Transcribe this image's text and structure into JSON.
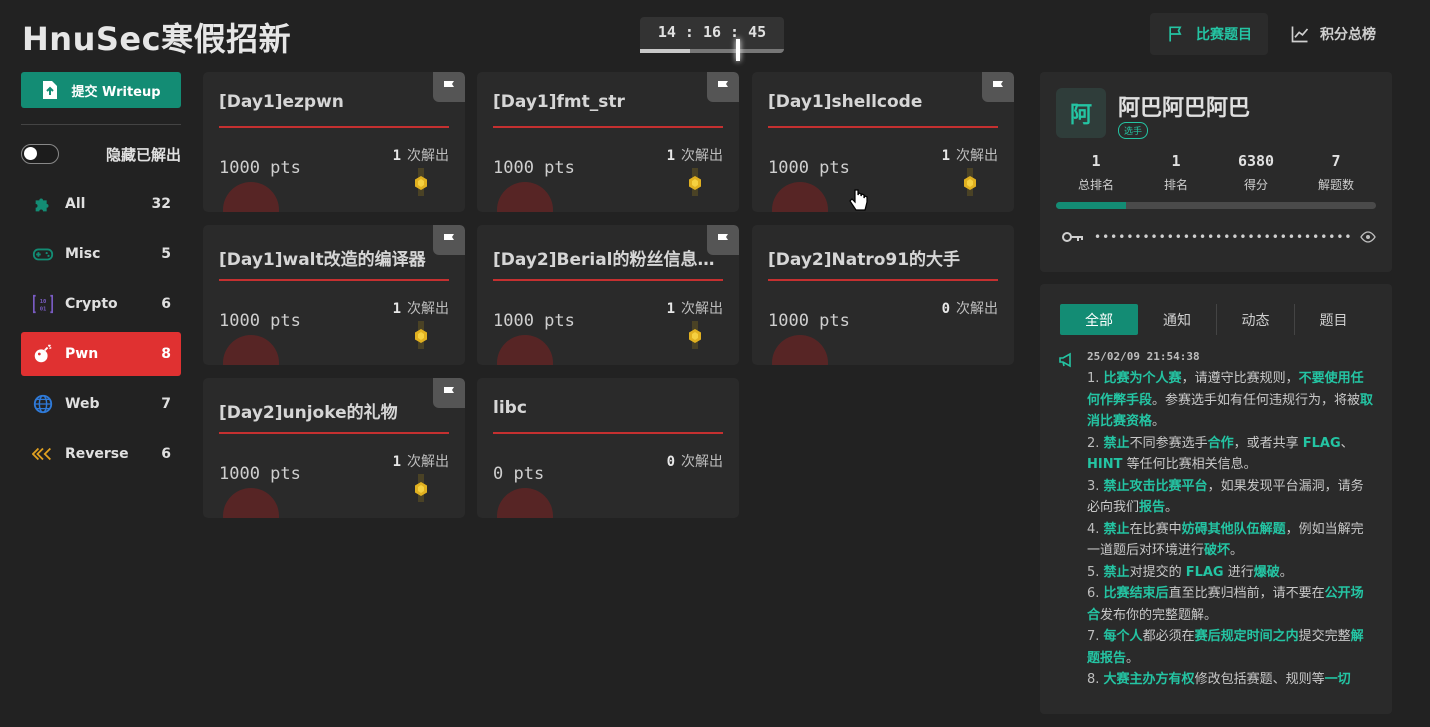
{
  "app": {
    "title": "HnuSec寒假招新",
    "timer": "14 : 16 : 45",
    "timer_progress": 0.35
  },
  "nav": {
    "challenges_label": "比赛题目",
    "scoreboard_label": "积分总榜"
  },
  "sidebar": {
    "submit_label": "提交 Writeup",
    "hide_solved_label": "隐藏已解出",
    "categories": [
      {
        "name": "All",
        "count": "32",
        "icon": "puzzle-icon"
      },
      {
        "name": "Misc",
        "count": "5",
        "icon": "gamepad-icon"
      },
      {
        "name": "Crypto",
        "count": "6",
        "icon": "binary-icon"
      },
      {
        "name": "Pwn",
        "count": "8",
        "icon": "bomb-icon",
        "active": true
      },
      {
        "name": "Web",
        "count": "7",
        "icon": "globe-icon"
      },
      {
        "name": "Reverse",
        "count": "6",
        "icon": "rewind-icon"
      }
    ]
  },
  "challenges": [
    {
      "title": "[Day1]ezpwn",
      "points": "1000 pts",
      "solves": "1",
      "solves_label": "次解出",
      "flagged": true,
      "medal": true
    },
    {
      "title": "[Day1]fmt_str",
      "points": "1000 pts",
      "solves": "1",
      "solves_label": "次解出",
      "flagged": true,
      "medal": true
    },
    {
      "title": "[Day1]shellcode",
      "points": "1000 pts",
      "solves": "1",
      "solves_label": "次解出",
      "flagged": true,
      "medal": true
    },
    {
      "title": "[Day1]walt改造的编译器",
      "points": "1000 pts",
      "solves": "1",
      "solves_label": "次解出",
      "flagged": true,
      "medal": true
    },
    {
      "title": "[Day2]Berial的粉丝信息收…",
      "points": "1000 pts",
      "solves": "1",
      "solves_label": "次解出",
      "flagged": true,
      "medal": true
    },
    {
      "title": "[Day2]Natro91的大手",
      "points": "1000 pts",
      "solves": "0",
      "solves_label": "次解出",
      "flagged": false,
      "medal": false
    },
    {
      "title": "[Day2]unjoke的礼物",
      "points": "1000 pts",
      "solves": "1",
      "solves_label": "次解出",
      "flagged": true,
      "medal": true
    },
    {
      "title": "libc",
      "points": "0 pts",
      "solves": "0",
      "solves_label": "次解出",
      "flagged": false,
      "medal": false
    }
  ],
  "profile": {
    "avatar_char": "阿",
    "name": "阿巴阿巴阿巴",
    "role": "选手",
    "stats": [
      {
        "value": "1",
        "label": "总排名"
      },
      {
        "value": "1",
        "label": "排名"
      },
      {
        "value": "6380",
        "label": "得分"
      },
      {
        "value": "7",
        "label": "解题数"
      }
    ],
    "progress": 0.22,
    "token_mask": "••••••••••••••••••••••••••••••••••"
  },
  "notices": {
    "tabs": [
      "全部",
      "通知",
      "动态",
      "题目"
    ],
    "time": "25/02/09 21:54:38"
  }
}
